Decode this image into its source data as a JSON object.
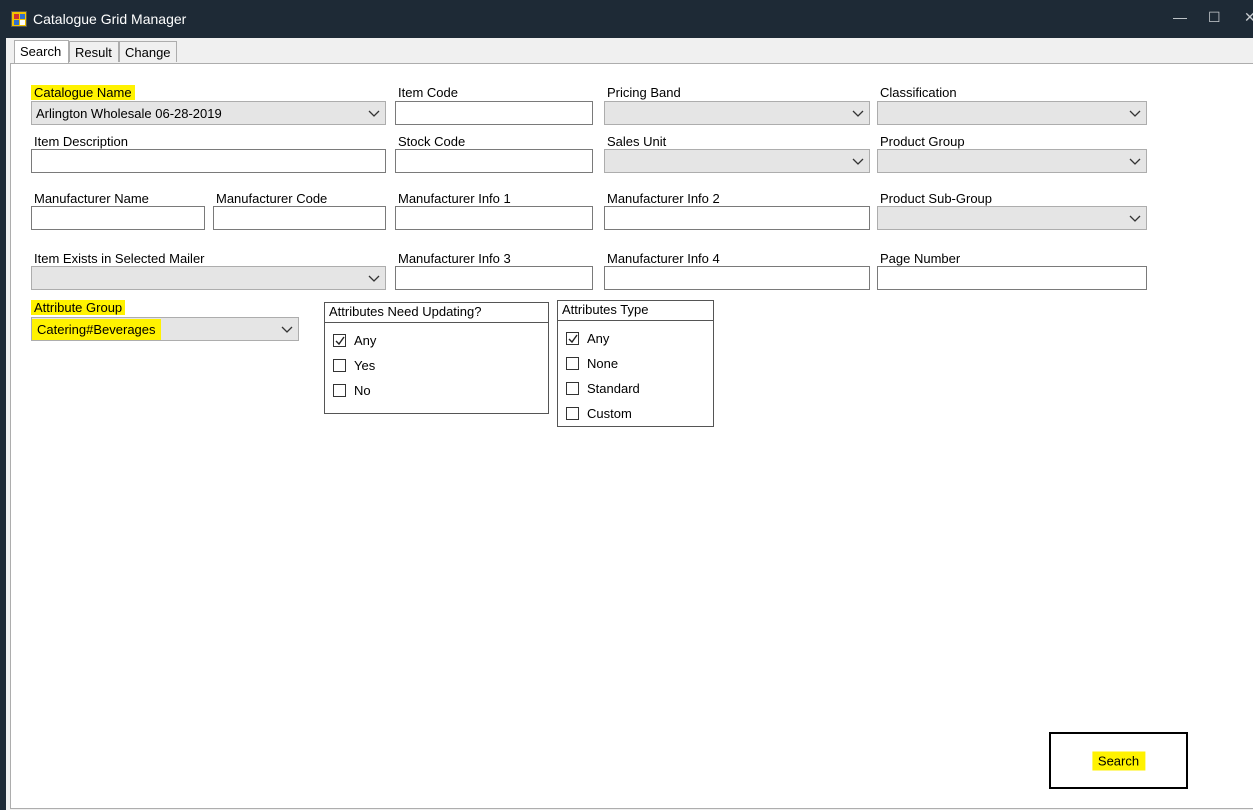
{
  "window": {
    "title": "Catalogue Grid Manager",
    "minimize_glyph": "—",
    "maximize_glyph": "☐",
    "close_glyph": "✕"
  },
  "tabs": [
    {
      "label": "Search",
      "active": true
    },
    {
      "label": "Result",
      "active": false
    },
    {
      "label": "Change",
      "active": false
    }
  ],
  "fields": {
    "catalogue_name": {
      "label": "Catalogue Name",
      "value": "Arlington Wholesale 06-28-2019"
    },
    "item_code": {
      "label": "Item Code",
      "value": ""
    },
    "pricing_band": {
      "label": "Pricing Band",
      "value": ""
    },
    "classification": {
      "label": "Classification",
      "value": ""
    },
    "item_description": {
      "label": "Item Description",
      "value": ""
    },
    "stock_code": {
      "label": "Stock Code",
      "value": ""
    },
    "sales_unit": {
      "label": "Sales Unit",
      "value": ""
    },
    "product_group": {
      "label": "Product Group",
      "value": ""
    },
    "manufacturer_name": {
      "label": "Manufacturer Name",
      "value": ""
    },
    "manufacturer_code": {
      "label": "Manufacturer Code",
      "value": ""
    },
    "manufacturer_info_1": {
      "label": "Manufacturer Info 1",
      "value": ""
    },
    "manufacturer_info_2": {
      "label": "Manufacturer Info 2",
      "value": ""
    },
    "product_sub_group": {
      "label": "Product Sub-Group",
      "value": ""
    },
    "item_exists_in_selected_mailer": {
      "label": "Item Exists in Selected Mailer",
      "value": ""
    },
    "manufacturer_info_3": {
      "label": "Manufacturer Info 3",
      "value": ""
    },
    "manufacturer_info_4": {
      "label": "Manufacturer Info 4",
      "value": ""
    },
    "page_number": {
      "label": "Page Number",
      "value": ""
    },
    "attribute_group": {
      "label": "Attribute Group",
      "value": "Catering#Beverages"
    }
  },
  "attributes_need_updating": {
    "title": "Attributes Need Updating?",
    "options": [
      {
        "label": "Any",
        "checked": true
      },
      {
        "label": "Yes",
        "checked": false
      },
      {
        "label": "No",
        "checked": false
      }
    ]
  },
  "attributes_type": {
    "title": "Attributes Type",
    "options": [
      {
        "label": "Any",
        "checked": true
      },
      {
        "label": "None",
        "checked": false
      },
      {
        "label": "Standard",
        "checked": false
      },
      {
        "label": "Custom",
        "checked": false
      }
    ]
  },
  "search_button": {
    "label": "Search"
  },
  "colors": {
    "highlight": "#fff200",
    "titlebar": "#1e2a36",
    "combo_bg": "#e5e5e5"
  }
}
